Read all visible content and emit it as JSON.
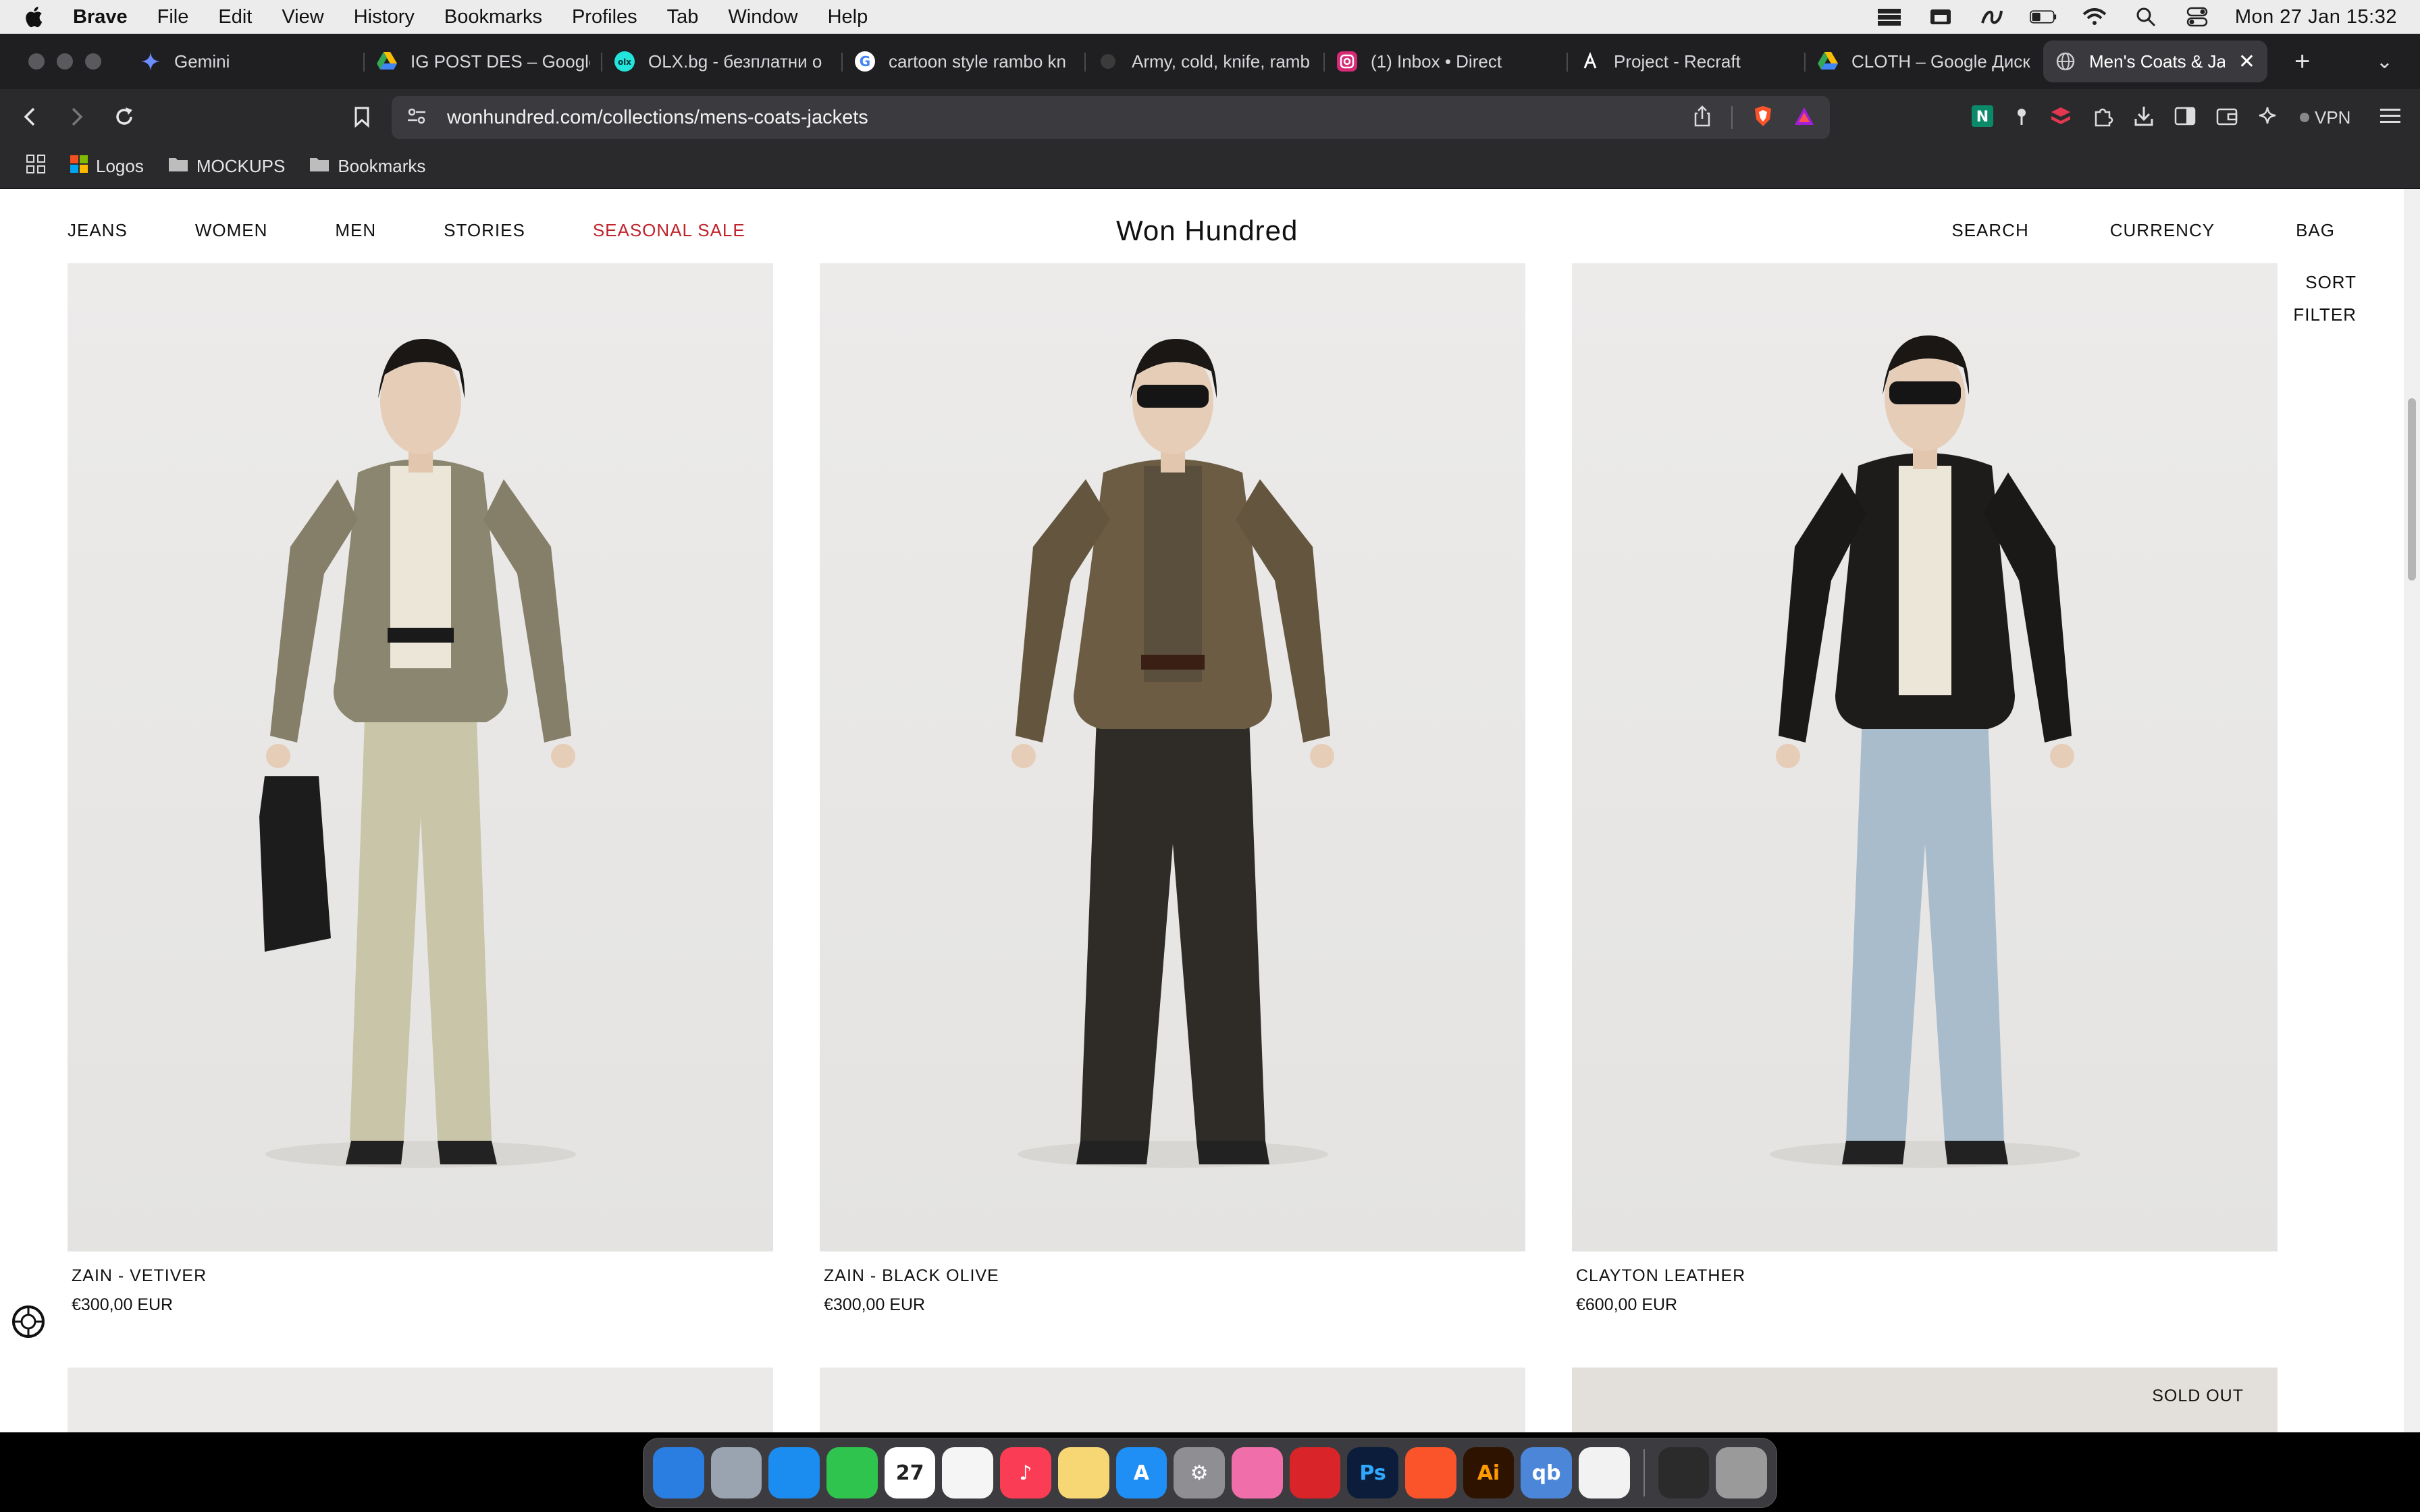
{
  "menubar": {
    "app_name": "Brave",
    "menus": [
      "File",
      "Edit",
      "View",
      "History",
      "Bookmarks",
      "Profiles",
      "Tab",
      "Window",
      "Help"
    ],
    "clock": "Mon 27 Jan  15:32"
  },
  "tabs": [
    {
      "label": "Gemini",
      "icon": "gemini-icon",
      "color": "#6a8cff"
    },
    {
      "label": "IG POST DES – Google",
      "icon": "google-drive-icon",
      "color": "#34a853"
    },
    {
      "label": "OLX.bg - безплатни о",
      "icon": "olx-icon",
      "color": "#23e5db"
    },
    {
      "label": "cartoon style rambo kn",
      "icon": "google-icon",
      "color": "#4285f4"
    },
    {
      "label": "Army, cold, knife, ramb",
      "icon": "generic-page-icon",
      "color": "#888888"
    },
    {
      "label": "(1) Inbox • Direct",
      "icon": "instagram-icon",
      "color": "#d62976"
    },
    {
      "label": "Project - Recraft",
      "icon": "recraft-icon",
      "color": "#ffffff"
    },
    {
      "label": "CLOTH – Google Диск",
      "icon": "google-drive-icon",
      "color": "#fbbc04"
    },
    {
      "label": "Men's Coats & Jac",
      "icon": "globe-icon",
      "color": "#cccccc",
      "active": true
    }
  ],
  "address_bar": {
    "url": "wonhundred.com/collections/mens-coats-jackets"
  },
  "extensions": {
    "vpn_label": "VPN"
  },
  "bookmarks": [
    {
      "label": "Logos",
      "icon": "microsoft-icon"
    },
    {
      "label": "MOCKUPS",
      "icon": "folder-icon"
    },
    {
      "label": "Bookmarks",
      "icon": "folder-icon"
    }
  ],
  "site": {
    "nav_left": [
      "JEANS",
      "WOMEN",
      "MEN",
      "STORIES",
      "SEASONAL SALE"
    ],
    "logo": "Won Hundred",
    "nav_right": [
      "SEARCH",
      "CURRENCY",
      "BAG"
    ],
    "sort_label": "SORT",
    "filter_label": "FILTER",
    "sold_out_label": "SOLD OUT",
    "sale_color": "#c0242b"
  },
  "products": [
    {
      "name": "ZAIN - VETIVER",
      "price": "€300,00 EUR",
      "jacket_color": "#8a8670",
      "pants_color": "#c9c5a8",
      "shirt_color": "#ece6d8",
      "sunglasses": false,
      "bag": true
    },
    {
      "name": "ZAIN - BLACK OLIVE",
      "price": "€300,00 EUR",
      "jacket_color": "#6b5c43",
      "pants_color": "#2f2b27",
      "shirt_color": "#5a4e3c",
      "sunglasses": true,
      "bag": false
    },
    {
      "name": "CLAYTON LEATHER",
      "price": "€600,00 EUR",
      "jacket_color": "#1e1c1b",
      "pants_color": "#a9bccb",
      "shirt_color": "#ece6d8",
      "sunglasses": true,
      "bag": false
    }
  ],
  "dock": [
    {
      "name": "finder-icon",
      "color": "#2a7de1",
      "glyph": ""
    },
    {
      "name": "launchpad-icon",
      "color": "#9aa4b0",
      "glyph": ""
    },
    {
      "name": "safari-icon",
      "color": "#1b8cf0",
      "glyph": ""
    },
    {
      "name": "facetime-icon",
      "color": "#2fc44e",
      "glyph": ""
    },
    {
      "name": "calendar-icon",
      "color": "#ffffff",
      "glyph": "27"
    },
    {
      "name": "reminders-icon",
      "color": "#f5f5f5",
      "glyph": ""
    },
    {
      "name": "music-icon",
      "color": "#fa3c55",
      "glyph": "♪"
    },
    {
      "name": "notes-icon",
      "color": "#f7d774",
      "glyph": ""
    },
    {
      "name": "app-store-icon",
      "color": "#1f8ef5",
      "glyph": "A"
    },
    {
      "name": "system-settings-icon",
      "color": "#8e8e93",
      "glyph": "⚙"
    },
    {
      "name": "image-app-icon",
      "color": "#f06ea9",
      "glyph": ""
    },
    {
      "name": "media-app-icon",
      "color": "#d9252a",
      "glyph": ""
    },
    {
      "name": "photoshop-icon",
      "color": "#0b1d3a",
      "glyph": "Ps"
    },
    {
      "name": "brave-icon",
      "color": "#fb542b",
      "glyph": ""
    },
    {
      "name": "illustrator-icon",
      "color": "#2e1400",
      "glyph": "Ai"
    },
    {
      "name": "qbittorrent-icon",
      "color": "#4b86d8",
      "glyph": "qb"
    },
    {
      "name": "freeform-icon",
      "color": "#f2f2f2",
      "glyph": ""
    },
    {
      "name": "screen-app-icon",
      "color": "#2b2b2b",
      "glyph": ""
    },
    {
      "name": "trash-icon",
      "color": "#9a9a9a",
      "glyph": ""
    }
  ]
}
